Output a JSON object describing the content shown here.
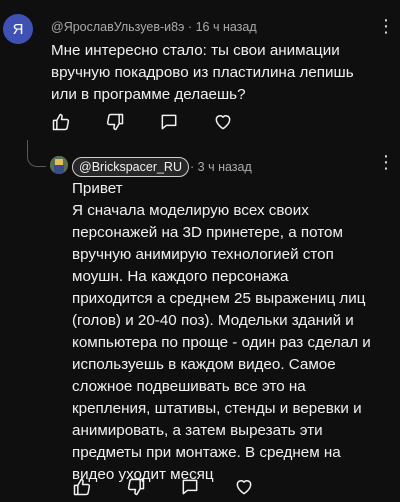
{
  "comments": [
    {
      "author": "@ЯрославУльзуев-и8э",
      "avatar_letter": "Я",
      "time": "16 ч назад",
      "text": "Мне интересно стало: ты свои анимации\nвручную покадрово из пластилина лепишь\nили в программе делаешь?",
      "more_label": "⋮"
    },
    {
      "author": "@Brickspacer_RU",
      "time": "3 ч назад",
      "text": "Привет\nЯ сначала моделирую всех своих\nперсонажей на 3D принетере, а потом\nвручную анимирую технологией стоп\nмоушн. На каждого персонажа\nприходится а среднем 25 выражениц лиц\n(голов) и 20-40 поз). Модельки зданий и\nкомпьютера по проще - один раз сделал и\nиспользуешь в каждом видео. Самое\nсложное подвешивать все это на\nкрепления, штативы, стенды и веревки и\nанимировать, а затем вырезать эти\nпредметы при монтаже. В среднем на\nвидео уходит месяц"
    }
  ],
  "separator": "·",
  "colors": {
    "background": "#0f0f0f",
    "text": "#f1f1f1",
    "muted": "#aaaaaa",
    "avatar": "#3f51b5"
  },
  "icons": [
    "like-icon",
    "dislike-icon",
    "reply-icon",
    "heart-icon"
  ]
}
